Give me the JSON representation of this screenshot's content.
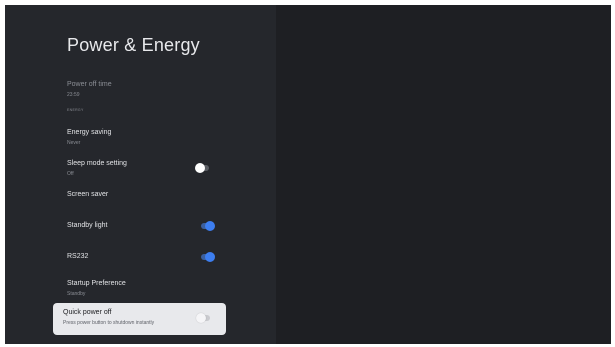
{
  "title": "Power & Energy",
  "items": {
    "power_off_time": {
      "label": "Power off time",
      "value": "23:59"
    },
    "section_energy": "ENERGY",
    "energy_saving": {
      "label": "Energy saving",
      "value": "Never"
    },
    "sleep_mode": {
      "label": "Sleep mode setting",
      "value": "Off",
      "toggle": "off"
    },
    "screen_saver": {
      "label": "Screen saver"
    },
    "standby_light": {
      "label": "Standby light",
      "toggle": "on"
    },
    "rs232": {
      "label": "RS232",
      "toggle": "on"
    },
    "startup_preference": {
      "label": "Startup Preference",
      "value": "Standby"
    },
    "quick_power_off": {
      "label": "Quick power off",
      "value": "Press power button to shutdown instantly",
      "toggle": "off"
    }
  },
  "colors": {
    "background": "#1e1f23",
    "panel": "#25272c",
    "accent": "#3d7ef0",
    "focused_card": "#e8e9ec"
  }
}
